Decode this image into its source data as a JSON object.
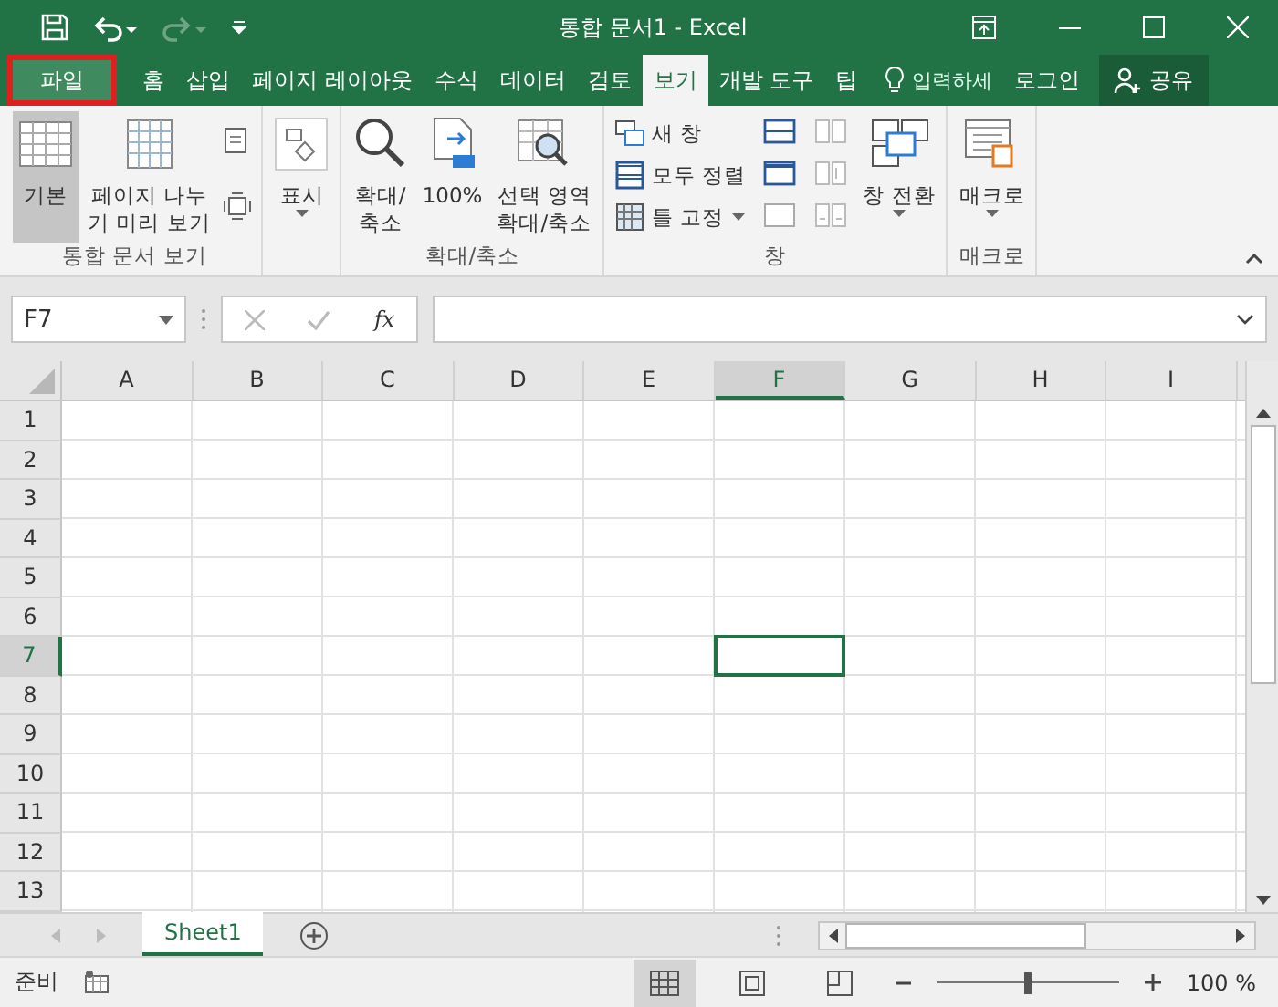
{
  "window": {
    "title": "통합 문서1 - Excel"
  },
  "tabs": [
    {
      "label": "파일",
      "selected": false,
      "kind": "file",
      "annotated": true
    },
    {
      "label": "홈",
      "selected": false,
      "kind": "tab"
    },
    {
      "label": "삽입",
      "selected": false,
      "kind": "tab"
    },
    {
      "label": "페이지 레이아웃",
      "selected": false,
      "kind": "tab"
    },
    {
      "label": "수식",
      "selected": false,
      "kind": "tab"
    },
    {
      "label": "데이터",
      "selected": false,
      "kind": "tab"
    },
    {
      "label": "검토",
      "selected": false,
      "kind": "tab"
    },
    {
      "label": "보기",
      "selected": true,
      "kind": "tab"
    },
    {
      "label": "개발 도구",
      "selected": false,
      "kind": "tab"
    },
    {
      "label": "팁",
      "selected": false,
      "kind": "tab"
    }
  ],
  "tell_me": {
    "text": "입력하세"
  },
  "account": {
    "login": "로그인",
    "share": "공유"
  },
  "ribbon": {
    "groups": [
      {
        "label": "통합 문서 보기",
        "buttons": [
          {
            "lines": [
              "기본"
            ],
            "selected": true
          },
          {
            "lines": [
              "페이지 나누",
              "기 미리 보기"
            ],
            "selected": false
          }
        ]
      },
      {
        "buttons": [
          {
            "lines": [
              "표시"
            ],
            "selected": false
          }
        ]
      },
      {
        "label": "확대/축소",
        "buttons": [
          {
            "lines": [
              "확대/",
              "축소"
            ],
            "selected": false
          },
          {
            "lines": [
              "100%"
            ],
            "selected": false
          },
          {
            "lines": [
              "선택 영역",
              "확대/축소"
            ],
            "selected": false
          }
        ]
      },
      {
        "label": "창",
        "buttons": [
          {
            "lines": [
              "새 창"
            ],
            "selected": false
          },
          {
            "lines": [
              "모두 정렬"
            ],
            "selected": false
          },
          {
            "lines": [
              "틀 고정"
            ],
            "selected": false
          },
          {
            "lines": [
              "창 전환"
            ],
            "selected": false
          }
        ]
      },
      {
        "label": "매크로",
        "buttons": [
          {
            "lines": [
              "매크로"
            ],
            "selected": false
          }
        ]
      }
    ]
  },
  "formula_bar": {
    "name_box": "F7",
    "function_symbol": "fx"
  },
  "columns": [
    {
      "label": "A",
      "selected": false
    },
    {
      "label": "B",
      "selected": false
    },
    {
      "label": "C",
      "selected": false
    },
    {
      "label": "D",
      "selected": false
    },
    {
      "label": "E",
      "selected": false
    },
    {
      "label": "F",
      "selected": true
    },
    {
      "label": "G",
      "selected": false
    },
    {
      "label": "H",
      "selected": false
    },
    {
      "label": "I",
      "selected": false
    }
  ],
  "rows": [
    {
      "label": "1",
      "selected": false
    },
    {
      "label": "2",
      "selected": false
    },
    {
      "label": "3",
      "selected": false
    },
    {
      "label": "4",
      "selected": false
    },
    {
      "label": "5",
      "selected": false
    },
    {
      "label": "6",
      "selected": false
    },
    {
      "label": "7",
      "selected": true
    },
    {
      "label": "8",
      "selected": false
    },
    {
      "label": "9",
      "selected": false
    },
    {
      "label": "10",
      "selected": false
    },
    {
      "label": "11",
      "selected": false
    },
    {
      "label": "12",
      "selected": false
    },
    {
      "label": "13",
      "selected": false
    }
  ],
  "sheets": [
    {
      "label": "Sheet1",
      "selected": true
    }
  ],
  "status_bar": {
    "status": "준비",
    "views": [
      {
        "selected": true
      },
      {
        "selected": false
      },
      {
        "selected": false
      }
    ],
    "zoom": {
      "level": 0.5,
      "reading": "100 %"
    }
  }
}
